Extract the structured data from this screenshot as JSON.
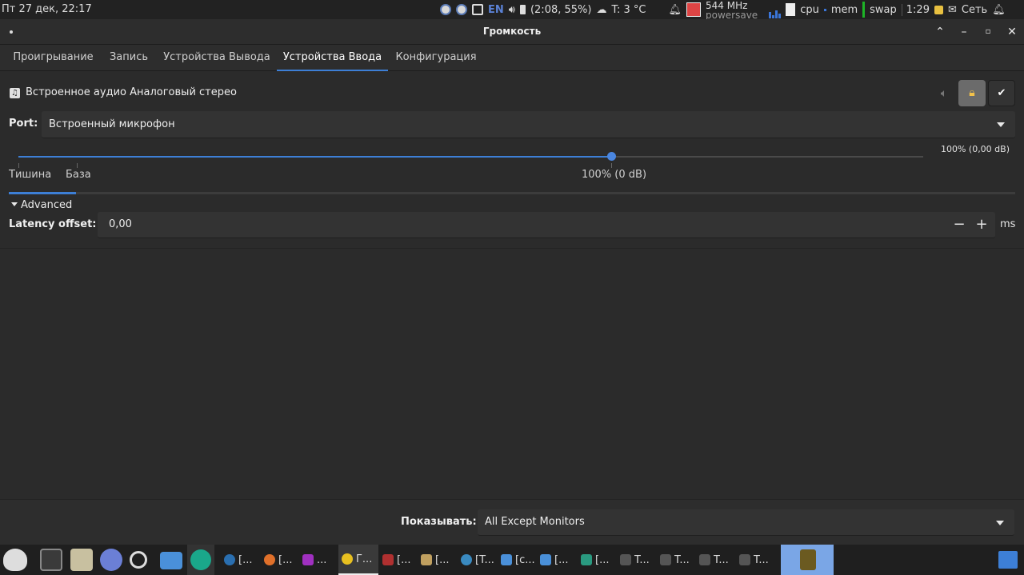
{
  "top_panel": {
    "datetime": "Пт 27 дек, 22:17",
    "keyboard_layout": "EN",
    "battery": "(2:08, 55%)",
    "temperature": "T: 3 °C",
    "cpu_freq": "544 MHz",
    "cpu_governor": "powersave",
    "cpu_label": "cpu",
    "mem_label": "mem",
    "swap_label": "swap",
    "clock": "1:29",
    "network_label": "Сеть"
  },
  "window": {
    "title": "Громкость",
    "controls": [
      "chevron-up-icon",
      "minimize-icon",
      "maximize-icon",
      "close-icon"
    ]
  },
  "tabs": [
    {
      "label": "Проигрывание",
      "active": false
    },
    {
      "label": "Запись",
      "active": false
    },
    {
      "label": "Устройства Вывода",
      "active": false
    },
    {
      "label": "Устройства Ввода",
      "active": true
    },
    {
      "label": "Конфигурация",
      "active": false
    }
  ],
  "device": {
    "name": "Встроенное аудио Аналоговый стерео",
    "port_label": "Port:",
    "port_value": "Встроенный микрофон",
    "volume_readout": "100% (0,00 dB)",
    "volume_fraction": 0.655,
    "level_fraction": 0.067,
    "mark_silence": "Тишина",
    "mark_base": "База",
    "mark_100": "100% (0 dB)"
  },
  "advanced": {
    "label": "Advanced",
    "latency_label": "Latency offset:",
    "latency_value": "0,00",
    "unit": "ms"
  },
  "bottom": {
    "show_label": "Показывать:",
    "show_value": "All Except Monitors"
  },
  "taskbar": {
    "tasks": [
      {
        "label": "[..."
      },
      {
        "label": "[..."
      },
      {
        "label": "..."
      },
      {
        "label": "Г..."
      },
      {
        "label": "[..."
      },
      {
        "label": "[..."
      },
      {
        "label": "[T..."
      },
      {
        "label": "[c..."
      },
      {
        "label": "[..."
      },
      {
        "label": "[..."
      },
      {
        "label": "T..."
      },
      {
        "label": "T..."
      },
      {
        "label": "T..."
      },
      {
        "label": "T..."
      }
    ]
  },
  "colors": {
    "accent": "#3d7fd6",
    "background": "#2b2b2b",
    "lock": "#f2c14a"
  }
}
